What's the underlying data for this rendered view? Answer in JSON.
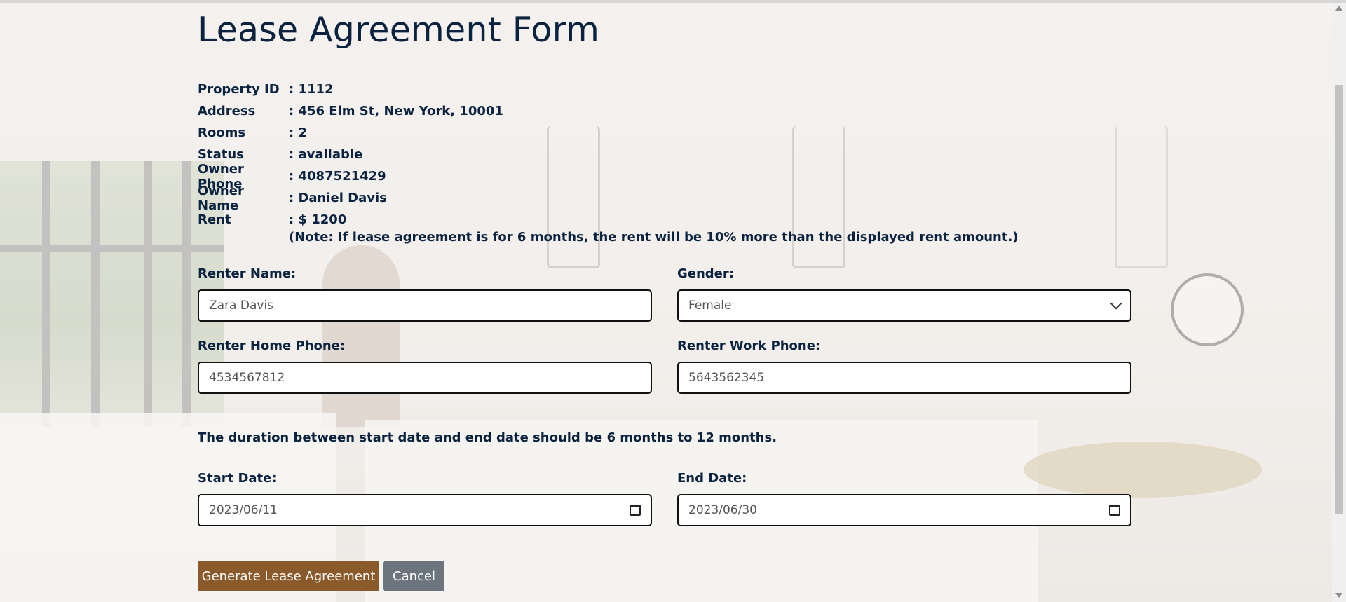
{
  "page": {
    "title": "Lease Agreement Form"
  },
  "property": [
    {
      "label": "Property ID",
      "value": ": 1112"
    },
    {
      "label": "Address",
      "value": ": 456 Elm St, New York, 10001"
    },
    {
      "label": "Rooms",
      "value": ": 2"
    },
    {
      "label": "Status",
      "value": ": available"
    },
    {
      "label": "Owner Phone",
      "value": ": 4087521429"
    },
    {
      "label": "Owner Name",
      "value": ": Daniel Davis"
    },
    {
      "label": "Rent",
      "value": ": $ 1200"
    }
  ],
  "note": "(Note: If lease agreement is for 6 months, the rent will be 10% more than the displayed rent amount.)",
  "form": {
    "renter_name": {
      "label": "Renter Name:",
      "value": "Zara Davis"
    },
    "gender": {
      "label": "Gender:",
      "value": "Female"
    },
    "home_phone": {
      "label": "Renter Home Phone:",
      "value": "4534567812"
    },
    "work_phone": {
      "label": "Renter Work Phone:",
      "value": "5643562345"
    },
    "duration_rule": "The duration between start date and end date should be 6 months to 12 months.",
    "start_date": {
      "label": "Start Date:",
      "value": "2023/06/11"
    },
    "end_date": {
      "label": "End Date:",
      "value": "2023/06/30"
    }
  },
  "buttons": {
    "generate": "Generate Lease Agreement",
    "cancel": "Cancel"
  },
  "icons": {
    "gender_dropdown": "chevron-down-icon",
    "start_date": "calendar-icon",
    "end_date": "calendar-icon"
  },
  "colors": {
    "primary_button": "#8a5a2a",
    "cancel_button": "#6c757d",
    "heading": "#0c2340"
  }
}
